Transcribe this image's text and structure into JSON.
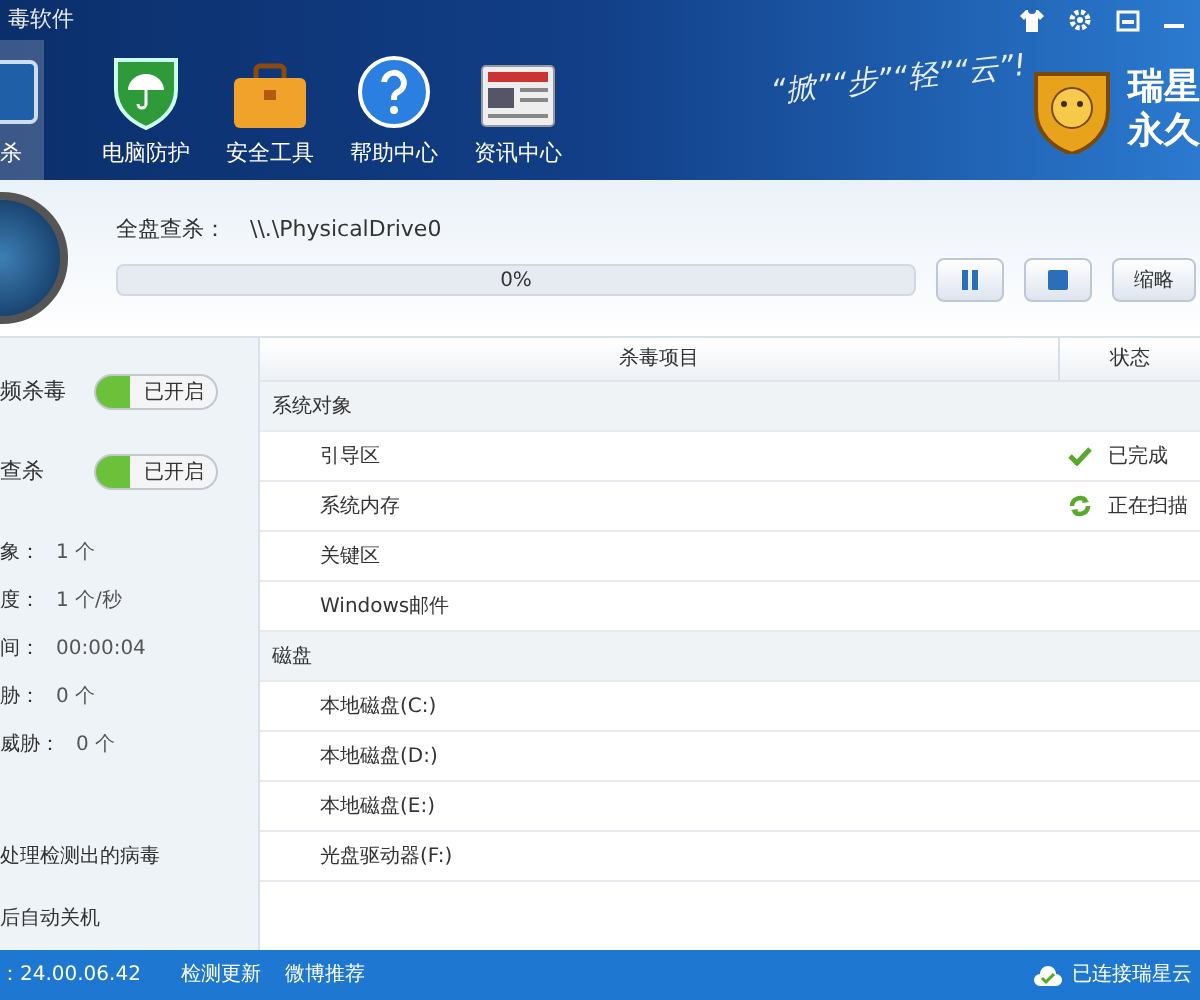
{
  "window": {
    "title": "毒软件"
  },
  "nav": [
    {
      "label": "杀",
      "selected": true
    },
    {
      "label": "电脑防护",
      "selected": false
    },
    {
      "label": "安全工具",
      "selected": false
    },
    {
      "label": "帮助中心",
      "selected": false
    },
    {
      "label": "资讯中心",
      "selected": false
    }
  ],
  "slogan": "“掀”“步”“轻”“云”!",
  "brand": [
    "瑞星",
    "永久"
  ],
  "scan": {
    "label": "全盘查杀：",
    "path": "\\\\.\\PhysicalDrive0",
    "progress": "0%",
    "level": 0,
    "mode_button": "缩略"
  },
  "toggles": [
    {
      "label": "频杀毒",
      "on": true,
      "state": "已开启"
    },
    {
      "label": "查杀",
      "on": true,
      "state": "已开启"
    }
  ],
  "stats": [
    {
      "label": "象：",
      "value": "1 个"
    },
    {
      "label": "度：",
      "value": "1 个/秒"
    },
    {
      "label": "间：",
      "value": "00:00:04"
    },
    {
      "label": "胁：",
      "value": "0 个"
    },
    {
      "label": "威胁：",
      "value": "0 个"
    }
  ],
  "options": [
    "处理检测出的病毒",
    "后自动关机"
  ],
  "table": {
    "columns": [
      "杀毒项目",
      "状态"
    ],
    "rows": [
      {
        "kind": "group",
        "name": "系统对象"
      },
      {
        "kind": "item",
        "name": "引导区",
        "status": {
          "kind": "done",
          "text": "已完成"
        }
      },
      {
        "kind": "item",
        "name": "系统内存",
        "status": {
          "kind": "scanning",
          "text": "正在扫描"
        }
      },
      {
        "kind": "item",
        "name": "关键区"
      },
      {
        "kind": "item",
        "name": "Windows邮件"
      },
      {
        "kind": "group",
        "name": "磁盘"
      },
      {
        "kind": "item",
        "name": "本地磁盘(C:)"
      },
      {
        "kind": "item",
        "name": "本地磁盘(D:)"
      },
      {
        "kind": "item",
        "name": "本地磁盘(E:)"
      },
      {
        "kind": "item",
        "name": "光盘驱动器(F:)"
      }
    ]
  },
  "status_bar": {
    "version": "：24.00.06.42",
    "links": [
      "检测更新",
      "微博推荐"
    ],
    "cloud": "已连接瑞星云"
  }
}
